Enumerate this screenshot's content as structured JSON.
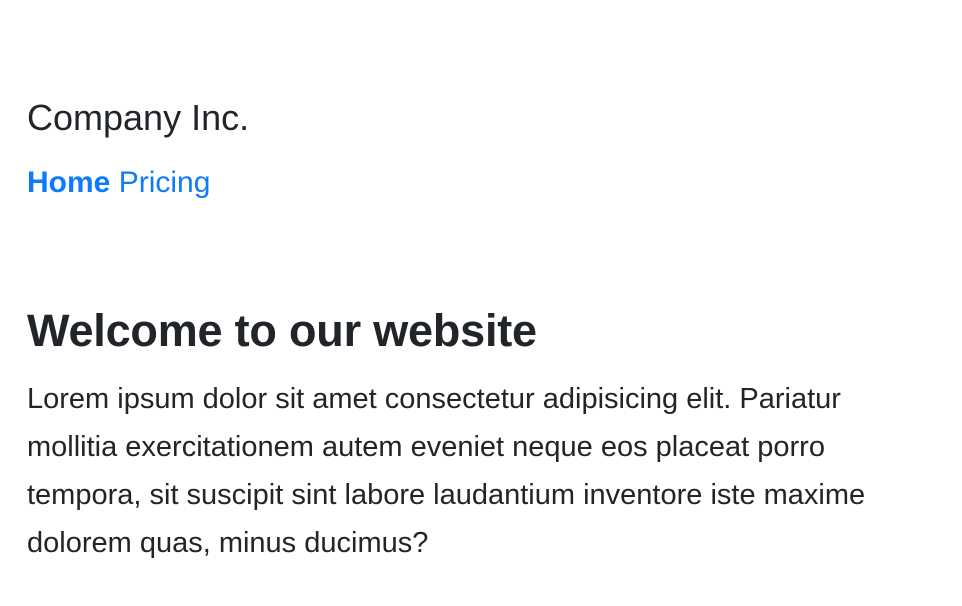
{
  "header": {
    "brand": "Company Inc.",
    "nav": [
      {
        "label": "Home",
        "active": true
      },
      {
        "label": "Pricing",
        "active": false
      }
    ]
  },
  "main": {
    "title": "Welcome to our website",
    "text": "Lorem ipsum dolor sit amet consectetur adipisicing elit. Pariatur mollitia exercitationem autem eveniet neque eos placeat porro tempora, sit suscipit sint labore laudantium inventore iste maxime dolorem quas, minus ducimus?"
  },
  "colors": {
    "text": "#212529",
    "link": "#0d7bfa",
    "background": "#ffffff"
  }
}
